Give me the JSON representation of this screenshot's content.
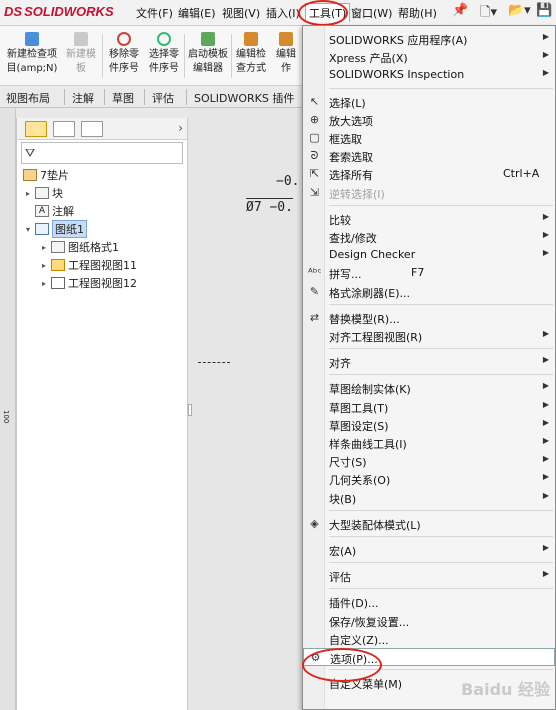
{
  "app": {
    "logo": "SOLIDWORKS",
    "logo_prefix": "DS"
  },
  "menubar": {
    "items": [
      "文件(F)",
      "编辑(E)",
      "视图(V)",
      "插入(I)",
      "工具(T)",
      "窗口(W)",
      "帮助(H)"
    ],
    "active": "工具(T)"
  },
  "toolbar": {
    "buttons": [
      {
        "label1": "新建检查项",
        "label2": "目(amp;N)",
        "icon": "new-check-icon",
        "disabled": false
      },
      {
        "label1": "新建模",
        "label2": "板",
        "icon": "new-template-icon",
        "disabled": true
      },
      {
        "label1": "移除零",
        "label2": "件序号",
        "icon": "remove-balloon-icon",
        "disabled": false
      },
      {
        "label1": "选择零",
        "label2": "件序号",
        "icon": "select-balloon-icon",
        "disabled": false
      },
      {
        "label1": "启动模板",
        "label2": "编辑器",
        "icon": "template-editor-icon",
        "disabled": false
      },
      {
        "label1": "编辑检",
        "label2": "查方式",
        "icon": "edit-check-icon",
        "disabled": false
      },
      {
        "label1": "编辑",
        "label2": "作",
        "icon": "edit-op-icon",
        "disabled": false
      }
    ]
  },
  "tabs": [
    "视图布局",
    "注解",
    "草图",
    "评估",
    "SOLIDWORKS 插件"
  ],
  "tree": {
    "root": "7垫片",
    "items": [
      {
        "label": "块",
        "indent": 1,
        "arrow": "▸"
      },
      {
        "label": "注解",
        "indent": 1,
        "arrow": ""
      },
      {
        "label": "图纸1",
        "indent": 1,
        "arrow": "▾",
        "selected": true
      },
      {
        "label": "图纸格式1",
        "indent": 2,
        "arrow": "▸"
      },
      {
        "label": "工程图视图11",
        "indent": 2,
        "arrow": "▸"
      },
      {
        "label": "工程图视图12",
        "indent": 2,
        "arrow": "▸"
      }
    ]
  },
  "canvas": {
    "dim1": "−0.",
    "dim2": "Ø7 −0.",
    "ruler_mark": "100"
  },
  "dropdown": {
    "items": [
      {
        "label": "SOLIDWORKS 应用程序(A)",
        "arrow": true
      },
      {
        "label": "Xpress 产品(X)",
        "arrow": true
      },
      {
        "label": "SOLIDWORKS Inspection",
        "arrow": true
      },
      {
        "sep": true
      },
      {
        "label": "选择(L)",
        "icon": "↖"
      },
      {
        "label": "放大选项",
        "icon": "⊕"
      },
      {
        "label": "框选取",
        "icon": "▢"
      },
      {
        "label": "套索选取",
        "icon": "ᘐ"
      },
      {
        "label": "选择所有",
        "icon": "⇱",
        "shortcut": "Ctrl+A"
      },
      {
        "label": "逆转选择(I)",
        "icon": "⇲",
        "disabled": true
      },
      {
        "sep": true
      },
      {
        "label": "比较",
        "arrow": true
      },
      {
        "label": "查找/修改",
        "arrow": true
      },
      {
        "label": "Design Checker",
        "arrow": true
      },
      {
        "label": "拼写...",
        "icon": "ᴬᵇᶜ",
        "shortcut": "F7"
      },
      {
        "label": "格式涂刷器(E)...",
        "icon": "✎"
      },
      {
        "sep": true
      },
      {
        "label": "替换模型(R)...",
        "icon": "⇄"
      },
      {
        "label": "对齐工程图视图(R)",
        "arrow": true
      },
      {
        "sep": true
      },
      {
        "label": "对齐",
        "arrow": true
      },
      {
        "sep": true
      },
      {
        "label": "草图绘制实体(K)",
        "arrow": true
      },
      {
        "label": "草图工具(T)",
        "arrow": true
      },
      {
        "label": "草图设定(S)",
        "arrow": true
      },
      {
        "label": "样条曲线工具(I)",
        "arrow": true
      },
      {
        "label": "尺寸(S)",
        "arrow": true
      },
      {
        "label": "几何关系(O)",
        "arrow": true
      },
      {
        "label": "块(B)",
        "arrow": true
      },
      {
        "sep": true
      },
      {
        "label": "大型装配体模式(L)",
        "icon": "◈"
      },
      {
        "sep": true
      },
      {
        "label": "宏(A)",
        "arrow": true
      },
      {
        "sep": true
      },
      {
        "label": "评估",
        "arrow": true
      },
      {
        "sep": true
      },
      {
        "label": "插件(D)..."
      },
      {
        "label": "保存/恢复设置..."
      },
      {
        "label": "自定义(Z)..."
      },
      {
        "label": "选项(P)...",
        "icon": "⚙",
        "hover": true
      },
      {
        "sep": true
      },
      {
        "label": "自定义菜单(M)"
      }
    ]
  },
  "watermark": "Baidu 经验"
}
